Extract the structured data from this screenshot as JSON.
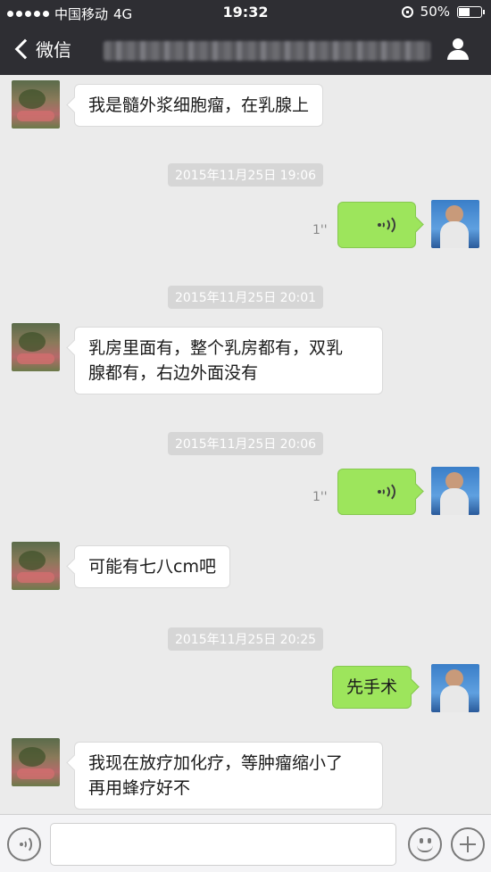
{
  "status_bar": {
    "carrier": "中国移动",
    "network": "4G",
    "time": "19:32",
    "battery": "50%"
  },
  "nav": {
    "back_label": "微信",
    "icons": {
      "back": "chevron-left-icon",
      "profile": "person-icon"
    }
  },
  "messages": [
    {
      "side": "left",
      "type": "text",
      "text": "我是髓外浆细胞瘤，在乳腺上"
    },
    {
      "type": "timestamp",
      "text": "2015年11月25日 19:06"
    },
    {
      "side": "right",
      "type": "voice",
      "duration": "1''"
    },
    {
      "type": "timestamp",
      "text": "2015年11月25日 20:01"
    },
    {
      "side": "left",
      "type": "text",
      "lines": [
        "乳房里面有，整个乳房都有，双乳",
        "腺都有，右边外面没有"
      ]
    },
    {
      "type": "timestamp",
      "text": "2015年11月25日 20:06"
    },
    {
      "side": "right",
      "type": "voice",
      "duration": "1''"
    },
    {
      "side": "left",
      "type": "text",
      "text": "可能有七八cm吧"
    },
    {
      "type": "timestamp",
      "text": "2015年11月25日 20:25"
    },
    {
      "side": "right",
      "type": "text",
      "text": "先手术"
    },
    {
      "side": "left",
      "type": "text",
      "lines": [
        "我现在放疗加化疗，等肿瘤缩小了",
        "再用蜂疗好不"
      ]
    }
  ],
  "colors": {
    "nav_bg": "#2e2e33",
    "chat_bg": "#ebebeb",
    "bubble_mine": "#9de55c",
    "bubble_other": "#ffffff"
  }
}
